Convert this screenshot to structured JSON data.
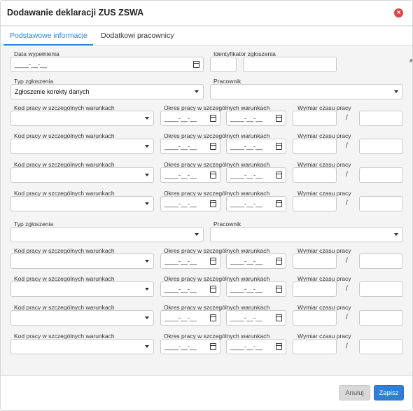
{
  "dialog": {
    "title": "Dodawanie deklaracji ZUS ZSWA"
  },
  "tabs": [
    {
      "label": "Podstawowe informacje",
      "active": true
    },
    {
      "label": "Dodatkowi pracownicy",
      "active": false
    }
  ],
  "tab_edge_fragment": "a",
  "form": {
    "fill_date_label": "Data wypełnienia",
    "date_placeholder": "____-__-__",
    "identifier_label": "Identyfikator zgłoszenia",
    "report_type_label": "Typ zgłoszenia",
    "employee_label": "Pracownik",
    "work_code_label": "Kod pracy w szczególnych warunkach",
    "period_label": "Okres pracy w szczególnych warunkach",
    "time_label": "Wymiar czasu pracy",
    "time_separator": "/",
    "sections": [
      {
        "report_type_value": "Zgłoszenie korekty danych",
        "employee_value": ""
      },
      {
        "report_type_value": "",
        "employee_value": ""
      }
    ]
  },
  "footer": {
    "cancel_label": "Anuluj",
    "save_label": "Zapisz"
  },
  "colors": {
    "accent": "#2d7fd8",
    "close": "#e04646"
  }
}
